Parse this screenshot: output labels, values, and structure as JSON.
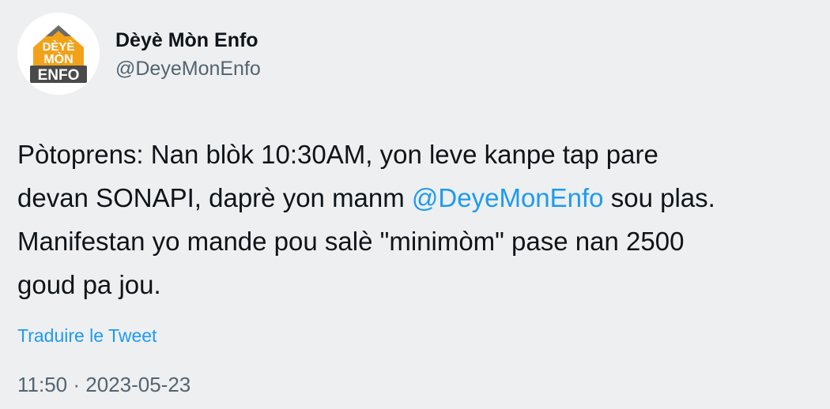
{
  "author": {
    "display_name": "Dèyè Mòn Enfo",
    "handle": "@DeyeMonEnfo",
    "avatar_logo_text": [
      "DÈYÈ",
      "MÒN",
      "ENFO"
    ]
  },
  "tweet": {
    "line1": "Pòtoprens: Nan blòk 10:30AM, yon leve kanpe tap pare",
    "line2_before": "devan SONAPI, daprè yon manm ",
    "line2_mention": "@DeyeMonEnfo",
    "line2_after": " sou plas.",
    "line3": "Manifestan yo mande pou salè \"minimòm\" pase nan 2500",
    "line4": "goud pa jou."
  },
  "translate_label": "Traduire le Tweet",
  "timestamp": "11:50 · 2023-05-23",
  "colors": {
    "background": "#eeeff0",
    "text": "#0f1419",
    "secondary_text": "#536471",
    "link": "#1d9bf0",
    "logo_orange": "#f2a21a",
    "logo_dark": "#4a4a4a"
  }
}
